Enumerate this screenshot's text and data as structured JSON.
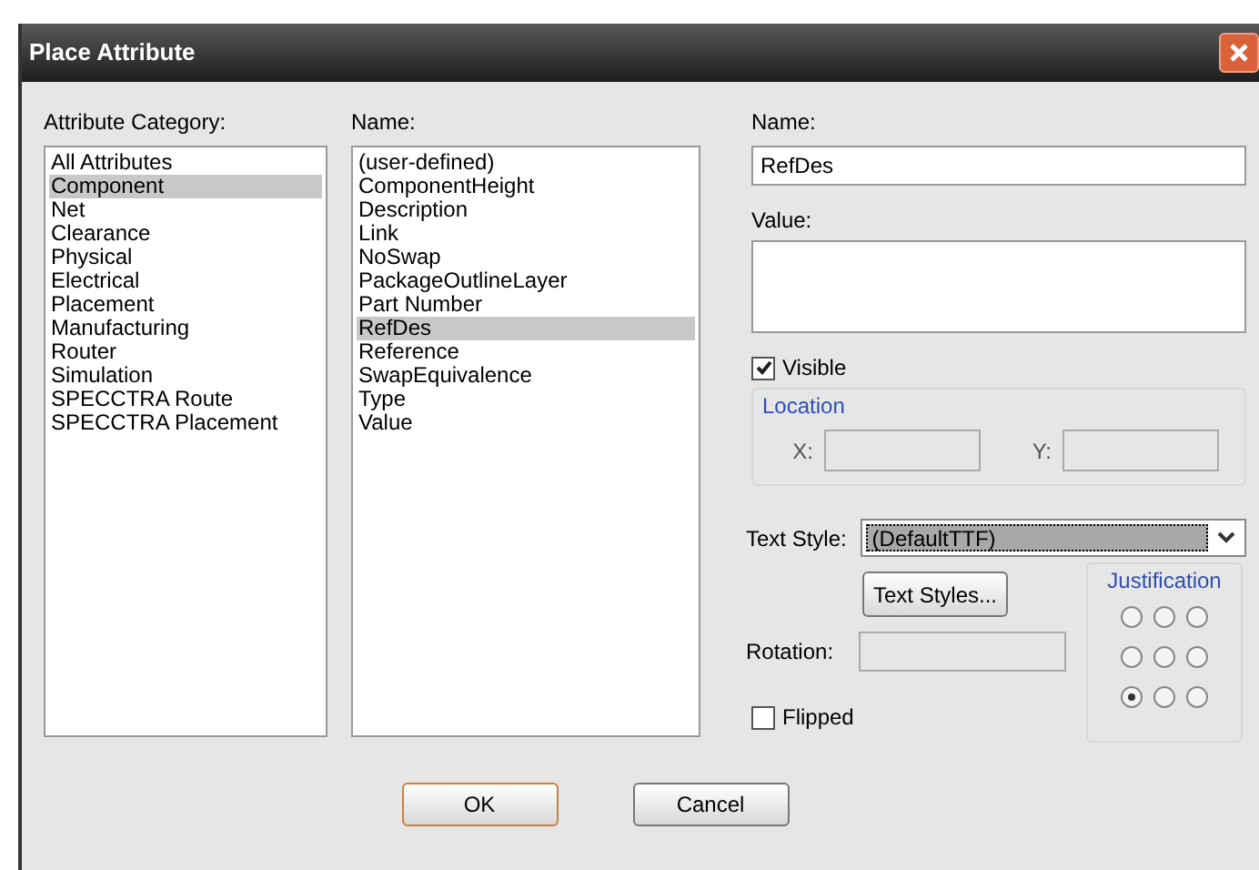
{
  "window": {
    "title": "Place Attribute"
  },
  "category": {
    "label": "Attribute Category:",
    "items": [
      {
        "label": "All Attributes",
        "selected": false
      },
      {
        "label": "Component",
        "selected": true
      },
      {
        "label": "Net",
        "selected": false
      },
      {
        "label": "Clearance",
        "selected": false
      },
      {
        "label": "Physical",
        "selected": false
      },
      {
        "label": "Electrical",
        "selected": false
      },
      {
        "label": "Placement",
        "selected": false
      },
      {
        "label": "Manufacturing",
        "selected": false
      },
      {
        "label": "Router",
        "selected": false
      },
      {
        "label": "Simulation",
        "selected": false
      },
      {
        "label": "SPECCTRA Route",
        "selected": false
      },
      {
        "label": "SPECCTRA Placement",
        "selected": false
      }
    ]
  },
  "names": {
    "label": "Name:",
    "items": [
      {
        "label": "(user-defined)",
        "selected": false
      },
      {
        "label": "ComponentHeight",
        "selected": false
      },
      {
        "label": "Description",
        "selected": false
      },
      {
        "label": "Link",
        "selected": false
      },
      {
        "label": "NoSwap",
        "selected": false
      },
      {
        "label": "PackageOutlineLayer",
        "selected": false
      },
      {
        "label": "Part Number",
        "selected": false
      },
      {
        "label": "RefDes",
        "selected": true
      },
      {
        "label": "Reference",
        "selected": false
      },
      {
        "label": "SwapEquivalence",
        "selected": false
      },
      {
        "label": "Type",
        "selected": false
      },
      {
        "label": "Value",
        "selected": false
      }
    ]
  },
  "name_field": {
    "label": "Name:",
    "value": "RefDes"
  },
  "value_field": {
    "label": "Value:"
  },
  "visible": {
    "label": "Visible",
    "checked": true
  },
  "location": {
    "title": "Location",
    "x_label": "X:",
    "y_label": "Y:"
  },
  "text_style": {
    "label": "Text Style:",
    "value": "(DefaultTTF)"
  },
  "text_styles_button": "Text Styles...",
  "rotation": {
    "label": "Rotation:"
  },
  "flipped": {
    "label": "Flipped",
    "checked": false
  },
  "justification": {
    "title": "Justification",
    "options": [
      {
        "selected": false
      },
      {
        "selected": false
      },
      {
        "selected": false
      },
      {
        "selected": false
      },
      {
        "selected": false
      },
      {
        "selected": false
      },
      {
        "selected": true
      },
      {
        "selected": false
      },
      {
        "selected": false
      }
    ]
  },
  "buttons": [
    {
      "label": "OK",
      "default": true
    },
    {
      "label": "Cancel",
      "default": false
    }
  ]
}
